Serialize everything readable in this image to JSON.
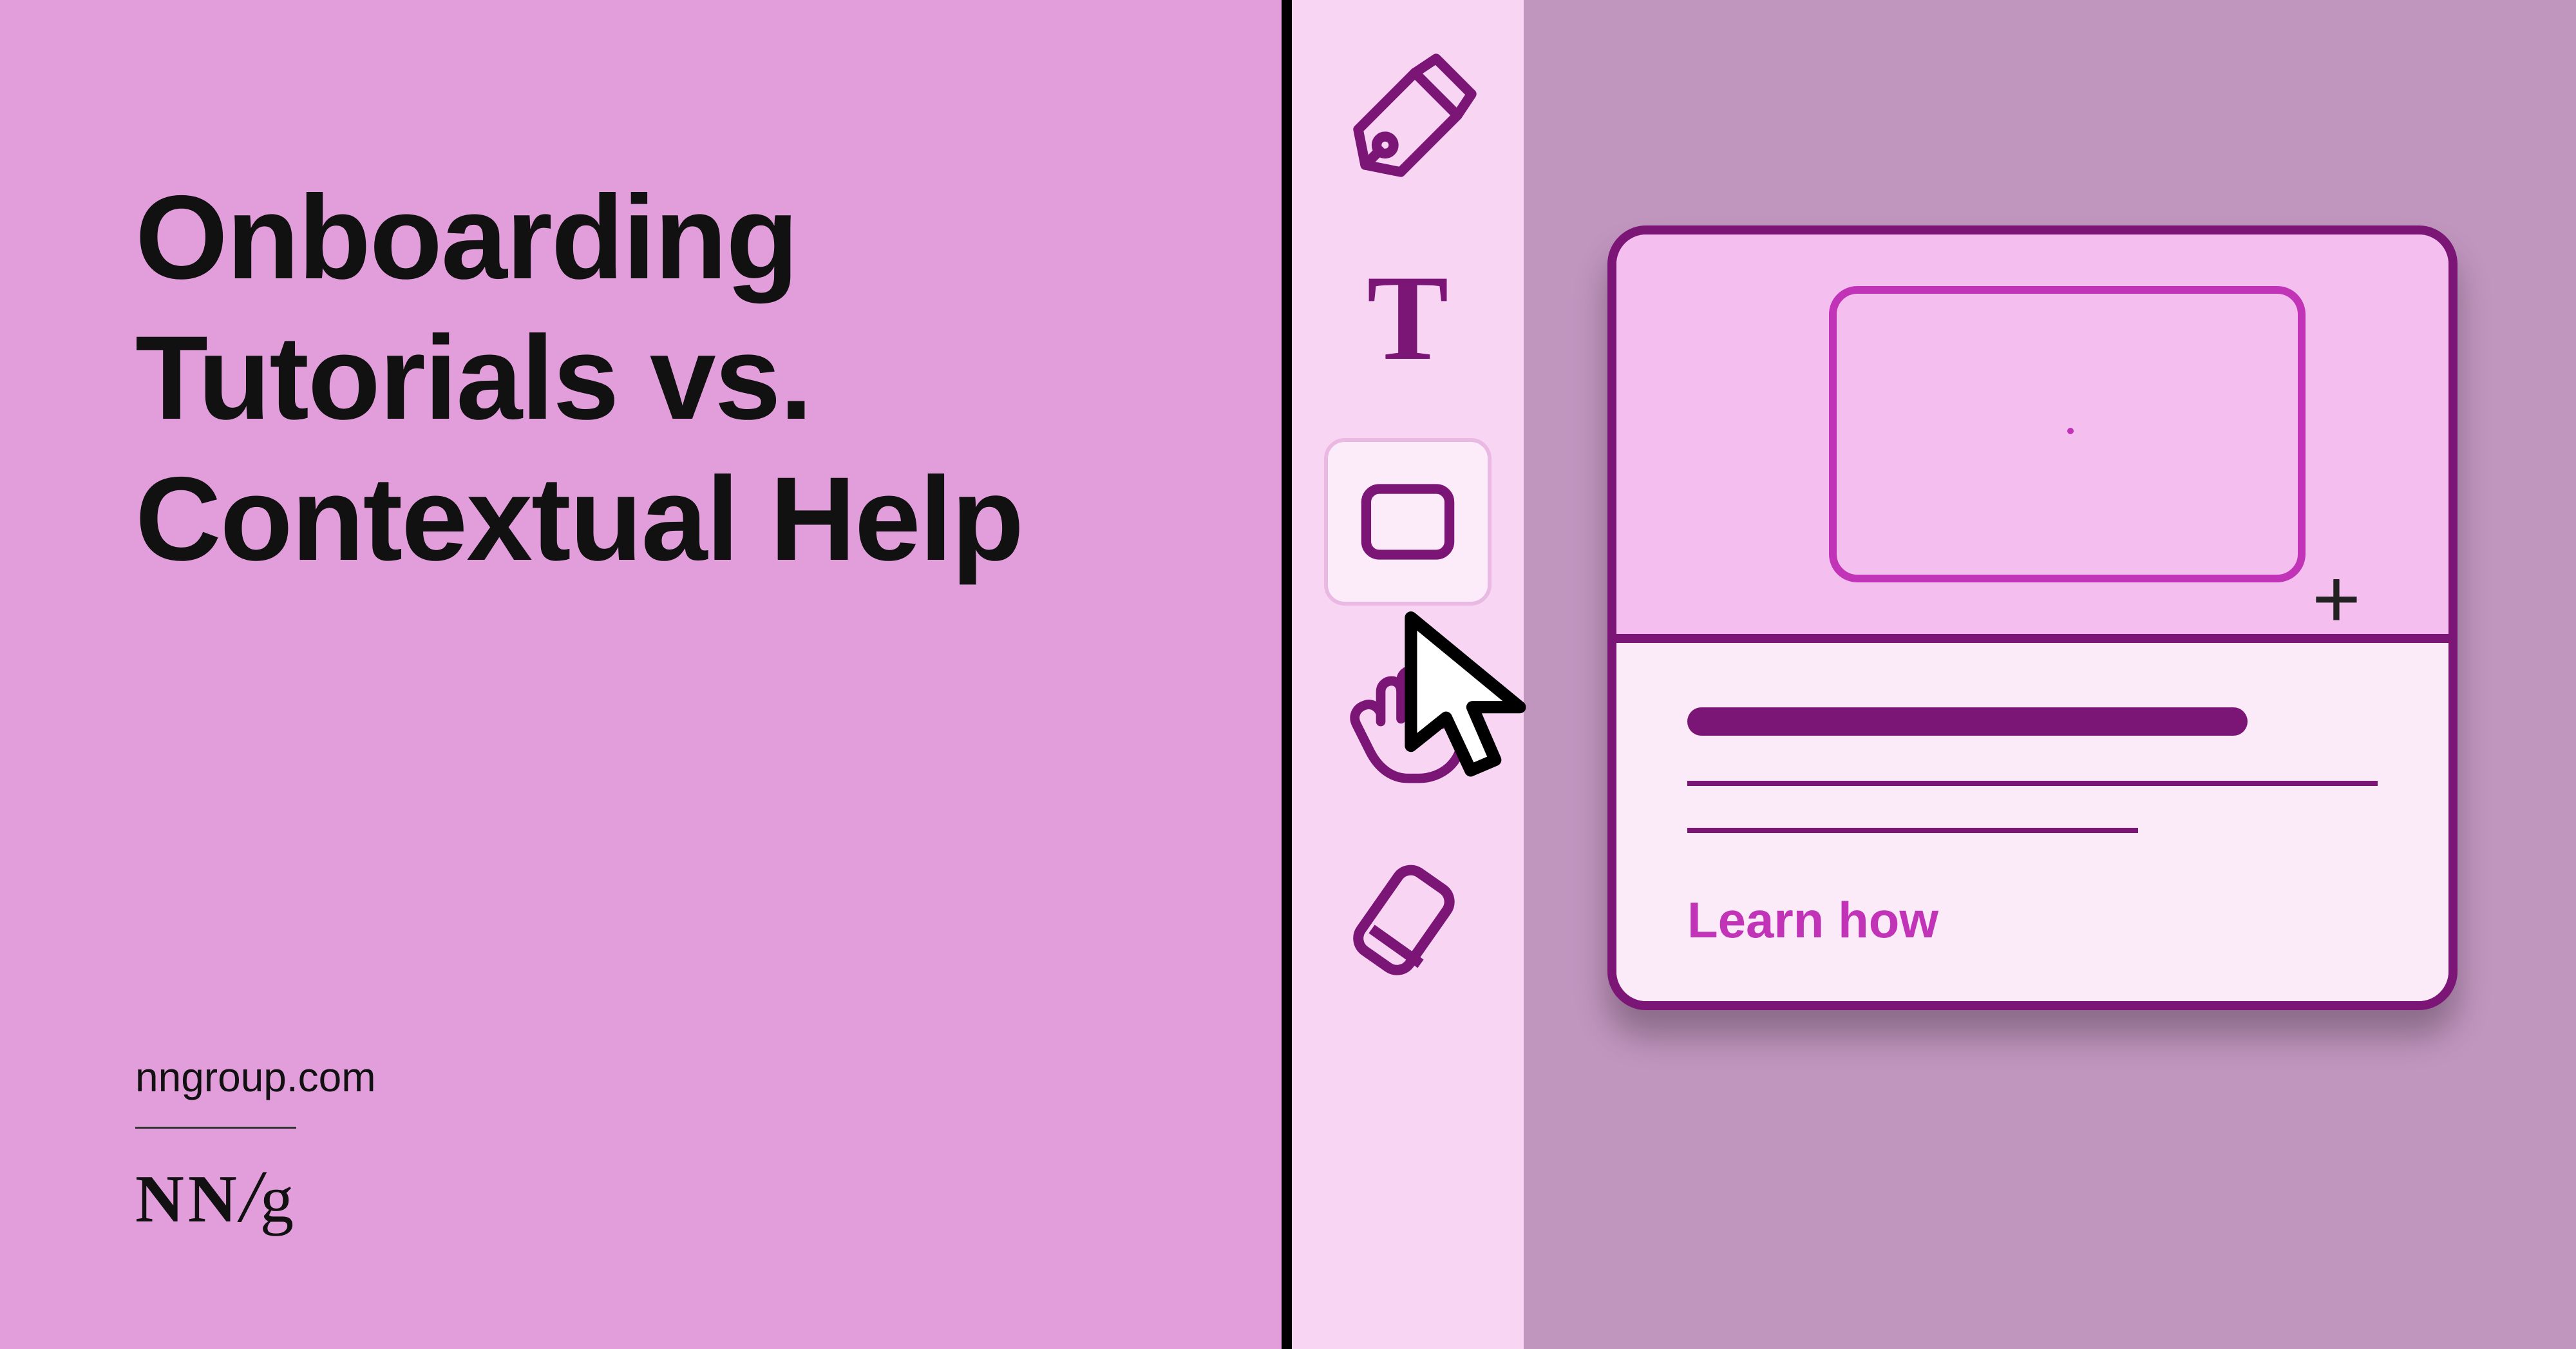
{
  "headline": "Onboarding Tutorials vs. Contextual Help",
  "site_url": "nngroup.com",
  "logo": {
    "nn": "NN",
    "slash": "/",
    "g": "g"
  },
  "toolbar": {
    "items": [
      {
        "name": "pen-icon"
      },
      {
        "name": "text-icon"
      },
      {
        "name": "rectangle-icon",
        "selected": true
      },
      {
        "name": "hand-icon"
      },
      {
        "name": "eraser-icon"
      }
    ]
  },
  "popover": {
    "link_text": "Learn how"
  },
  "colors": {
    "left_bg": "#E29EDB",
    "toolbar_bg": "#F8D6F3",
    "canvas_bg": "#C095BE",
    "accent": "#7B1677",
    "bright": "#C134B8"
  }
}
